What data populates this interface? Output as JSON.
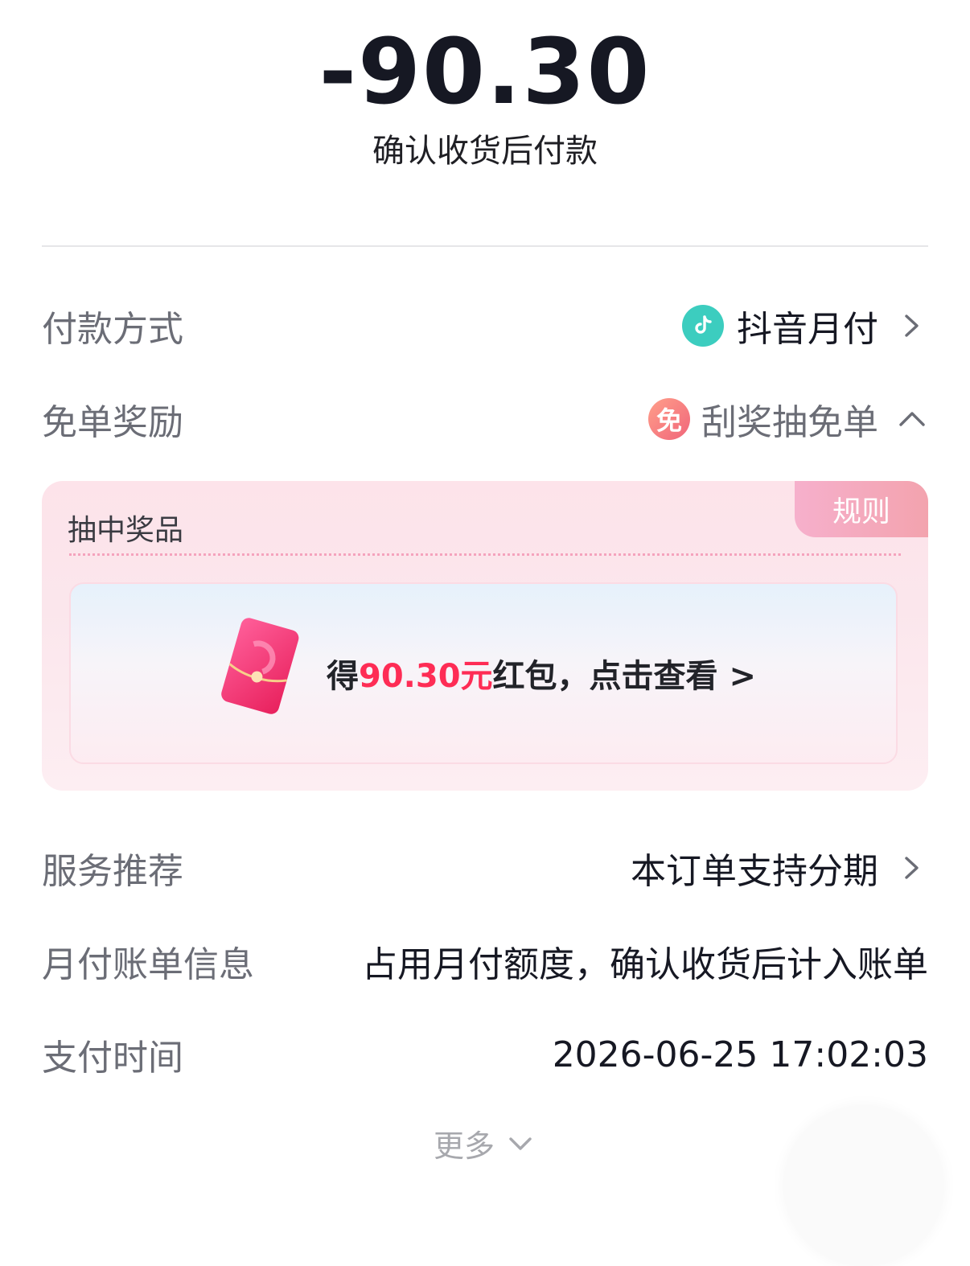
{
  "header": {
    "amount": "-90.30",
    "subtitle": "确认收货后付款"
  },
  "rows": {
    "payment_method": {
      "label": "付款方式",
      "value": "抖音月付",
      "icon": "douyin-pay-icon"
    },
    "free_reward": {
      "label": "免单奖励",
      "value": "刮奖抽免单",
      "icon_text": "免",
      "icon": "free-order-icon"
    },
    "service": {
      "label": "服务推荐",
      "value": "本订单支持分期"
    },
    "bill_info": {
      "label": "月付账单信息",
      "value": "占用月付额度，确认收货后计入账单"
    },
    "pay_time": {
      "label": "支付时间",
      "value": "2026-06-25 17:02:03"
    }
  },
  "prize": {
    "title": "抽中奖品",
    "rules": "规则",
    "text_before": "得",
    "amount": "90.30元",
    "text_after": "红包，点击查看 >"
  },
  "footer": {
    "more": "更多"
  },
  "colors": {
    "accent_red": "#fe2c55",
    "pay_teal": "#3ccdbf",
    "label_gray": "#6b6d76"
  }
}
